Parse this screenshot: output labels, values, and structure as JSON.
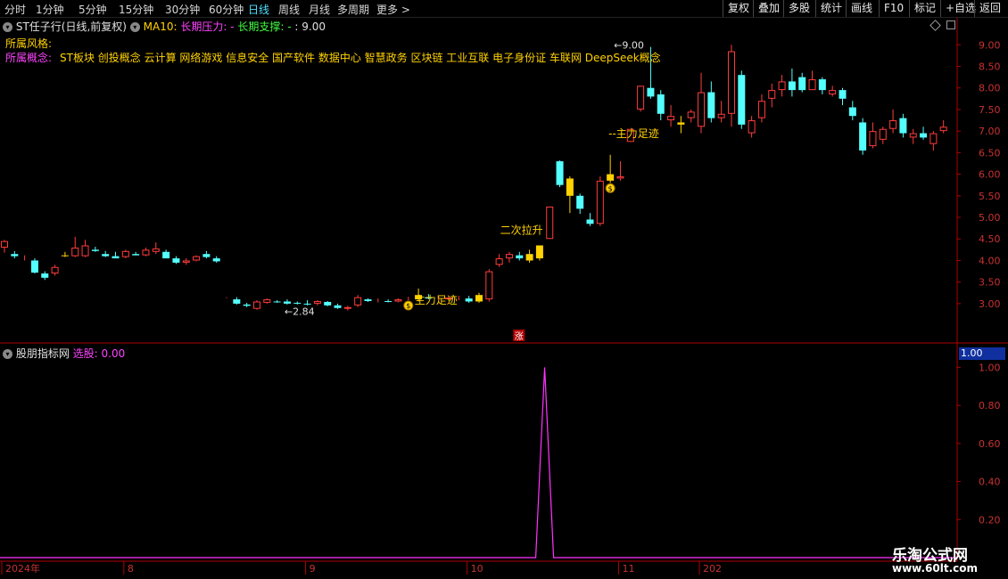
{
  "toolbar": {
    "left_items": [
      {
        "label": "分时",
        "active": false
      },
      {
        "label": "1分钟",
        "active": false
      },
      {
        "label": "5分钟",
        "active": false
      },
      {
        "label": "15分钟",
        "active": false
      },
      {
        "label": "30分钟",
        "active": false
      },
      {
        "label": "60分钟",
        "active": false
      },
      {
        "label": "日线",
        "active": true
      },
      {
        "label": "周线",
        "active": false
      },
      {
        "label": "月线",
        "active": false
      },
      {
        "label": "多周期",
        "active": false
      },
      {
        "label": "更多 >",
        "active": false
      }
    ],
    "right_items": [
      "复权",
      "叠加",
      "多股",
      "统计",
      "画线",
      "F10",
      "标记",
      "+自选",
      "返回"
    ]
  },
  "kline_info": {
    "title": "ST任子行(日线,前复权)",
    "ma": "MA10:",
    "pressure": "长期压力: -",
    "support": "长期支撑: -",
    "value": ": 9.00"
  },
  "concepts": {
    "style_label": "所属风格:",
    "concept_label": "所属概念:",
    "concept_value": "ST板块 创投概念 云计算 网络游戏 信息安全 国产软件 数据中心 智慧政务 区块链 工业互联 电子身份证 车联网 DeepSeek概念"
  },
  "indicator": {
    "name": "股朋指标网",
    "select_label": "选股: 0.00",
    "value_box": "1.00"
  },
  "watermark": {
    "title": "乐淘公式网",
    "url": "www.60lt.com"
  },
  "colors": {
    "up": "#ff3c3c",
    "down": "#54ffff",
    "highlight": "#ffd200",
    "indicator_line": "#ff33ff",
    "axis": "#b00000",
    "axis_text": "#c83232"
  },
  "chart_data": {
    "type": "candlestick",
    "price_axis": {
      "ticks": [
        "9.00",
        "8.50",
        "8.00",
        "7.50",
        "7.00",
        "6.50",
        "6.00",
        "5.50",
        "5.00",
        "4.50",
        "4.00",
        "3.50",
        "3.00"
      ],
      "range": [
        2.75,
        9.15
      ]
    },
    "indicator_axis": {
      "ticks": [
        "1.00",
        "0.80",
        "0.60",
        "0.40",
        "0.20"
      ],
      "range": [
        0,
        1.03
      ]
    },
    "x_labels": [
      {
        "label": "2024年",
        "index": 0
      },
      {
        "label": "8",
        "index": 12
      },
      {
        "label": "9",
        "index": 30
      },
      {
        "label": "10",
        "index": 46
      },
      {
        "label": "11",
        "index": 61
      },
      {
        "label": "202",
        "index": 69
      }
    ],
    "annotations": [
      {
        "text": "2.84",
        "index": 28,
        "price": 2.84
      },
      {
        "text": "主力足迹",
        "index": 40,
        "price": 3.0
      },
      {
        "text": "二次拉升",
        "index": 49,
        "price": 4.62
      },
      {
        "text": "9.00",
        "index": 60,
        "price": 9.0
      },
      {
        "text": "--主力足迹",
        "index": 60,
        "price": 6.86
      },
      {
        "text": "涨",
        "index": 51,
        "price": 2.77
      }
    ],
    "candles": [
      {
        "o": 4.3,
        "h": 4.48,
        "l": 4.18,
        "c": 4.45
      },
      {
        "o": 4.15,
        "h": 4.22,
        "l": 4.05,
        "c": 4.1
      },
      {
        "o": 4.05,
        "h": 4.12,
        "l": 4.0,
        "c": 4.05
      },
      {
        "o": 4.0,
        "h": 4.05,
        "l": 3.7,
        "c": 3.72
      },
      {
        "o": 3.7,
        "h": 3.75,
        "l": 3.55,
        "c": 3.6
      },
      {
        "o": 3.7,
        "h": 3.9,
        "l": 3.65,
        "c": 3.85
      },
      {
        "o": 4.1,
        "h": 4.2,
        "l": 4.08,
        "c": 4.12
      },
      {
        "o": 4.1,
        "h": 4.55,
        "l": 4.08,
        "c": 4.3
      },
      {
        "o": 4.1,
        "h": 4.48,
        "l": 4.08,
        "c": 4.35
      },
      {
        "o": 4.25,
        "h": 4.32,
        "l": 4.2,
        "c": 4.22
      },
      {
        "o": 4.15,
        "h": 4.22,
        "l": 4.08,
        "c": 4.1
      },
      {
        "o": 4.1,
        "h": 4.2,
        "l": 4.05,
        "c": 4.05
      },
      {
        "o": 4.08,
        "h": 4.25,
        "l": 4.05,
        "c": 4.22
      },
      {
        "o": 4.15,
        "h": 4.2,
        "l": 4.12,
        "c": 4.12
      },
      {
        "o": 4.12,
        "h": 4.3,
        "l": 4.1,
        "c": 4.25
      },
      {
        "o": 4.2,
        "h": 4.42,
        "l": 4.15,
        "c": 4.28
      },
      {
        "o": 4.2,
        "h": 4.25,
        "l": 4.05,
        "c": 4.05
      },
      {
        "o": 4.05,
        "h": 4.1,
        "l": 3.92,
        "c": 3.95
      },
      {
        "o": 3.95,
        "h": 4.05,
        "l": 3.9,
        "c": 4.0
      },
      {
        "o": 4.0,
        "h": 4.12,
        "l": 3.98,
        "c": 4.1
      },
      {
        "o": 4.15,
        "h": 4.22,
        "l": 4.05,
        "c": 4.08
      },
      {
        "o": 4.05,
        "h": 4.1,
        "l": 3.95,
        "c": 3.98
      },
      {
        "o": 3.14,
        "h": 3.15,
        "l": 3.13,
        "c": 3.14
      },
      {
        "o": 3.1,
        "h": 3.15,
        "l": 2.98,
        "c": 3.0
      },
      {
        "o": 2.98,
        "h": 3.02,
        "l": 2.92,
        "c": 2.95
      },
      {
        "o": 2.88,
        "h": 3.08,
        "l": 2.86,
        "c": 3.05
      },
      {
        "o": 3.02,
        "h": 3.12,
        "l": 3.0,
        "c": 3.1
      },
      {
        "o": 3.05,
        "h": 3.08,
        "l": 3.02,
        "c": 3.04
      },
      {
        "o": 3.05,
        "h": 3.1,
        "l": 2.98,
        "c": 3.0
      },
      {
        "o": 3.02,
        "h": 3.05,
        "l": 2.98,
        "c": 3.0
      },
      {
        "o": 3.0,
        "h": 3.08,
        "l": 2.96,
        "c": 2.98
      },
      {
        "o": 3.0,
        "h": 3.08,
        "l": 2.96,
        "c": 3.06
      },
      {
        "o": 3.04,
        "h": 3.06,
        "l": 2.94,
        "c": 2.96
      },
      {
        "o": 2.96,
        "h": 3.0,
        "l": 2.88,
        "c": 2.9
      },
      {
        "o": 2.88,
        "h": 2.95,
        "l": 2.84,
        "c": 2.92
      },
      {
        "o": 2.96,
        "h": 3.2,
        "l": 2.92,
        "c": 3.15
      },
      {
        "o": 3.1,
        "h": 3.12,
        "l": 3.04,
        "c": 3.06
      },
      {
        "o": 3.06,
        "h": 3.12,
        "l": 3.03,
        "c": 3.08
      },
      {
        "o": 3.06,
        "h": 3.1,
        "l": 3.03,
        "c": 3.04
      },
      {
        "o": 3.05,
        "h": 3.12,
        "l": 3.03,
        "c": 3.1
      },
      {
        "o": 3.12,
        "h": 3.16,
        "l": 3.08,
        "c": 3.14
      },
      {
        "o": 3.1,
        "h": 3.35,
        "l": 3.05,
        "c": 3.2
      },
      {
        "o": 3.15,
        "h": 3.22,
        "l": 3.1,
        "c": 3.12
      },
      {
        "o": 3.12,
        "h": 3.18,
        "l": 3.08,
        "c": 3.14
      },
      {
        "o": 3.1,
        "h": 3.16,
        "l": 3.06,
        "c": 3.14
      },
      {
        "o": 3.12,
        "h": 3.18,
        "l": 3.08,
        "c": 3.12
      },
      {
        "o": 3.12,
        "h": 3.18,
        "l": 3.02,
        "c": 3.05
      },
      {
        "o": 3.05,
        "h": 3.25,
        "l": 3.02,
        "c": 3.2
      },
      {
        "o": 3.1,
        "h": 3.8,
        "l": 3.05,
        "c": 3.75
      },
      {
        "o": 3.9,
        "h": 4.15,
        "l": 3.85,
        "c": 4.05
      },
      {
        "o": 4.05,
        "h": 4.2,
        "l": 3.95,
        "c": 4.15
      },
      {
        "o": 4.12,
        "h": 4.2,
        "l": 4.0,
        "c": 4.05
      },
      {
        "o": 4.0,
        "h": 4.25,
        "l": 3.95,
        "c": 4.15
      },
      {
        "o": 4.05,
        "h": 4.35,
        "l": 4.0,
        "c": 4.35
      },
      {
        "o": 4.5,
        "h": 5.25,
        "l": 4.5,
        "c": 5.25
      },
      {
        "o": 6.3,
        "h": 6.32,
        "l": 5.7,
        "c": 5.75
      },
      {
        "o": 5.9,
        "h": 5.95,
        "l": 5.1,
        "c": 5.5
      },
      {
        "o": 5.5,
        "h": 5.55,
        "l": 5.08,
        "c": 5.2
      },
      {
        "o": 4.95,
        "h": 5.1,
        "l": 4.8,
        "c": 4.85
      },
      {
        "o": 4.85,
        "h": 5.95,
        "l": 4.8,
        "c": 5.85
      },
      {
        "o": 5.85,
        "h": 6.45,
        "l": 5.8,
        "c": 6.0
      },
      {
        "o": 5.9,
        "h": 6.3,
        "l": 5.85,
        "c": 5.95
      },
      {
        "o": 6.75,
        "h": 7.05,
        "l": 6.75,
        "c": 7.05
      },
      {
        "o": 7.5,
        "h": 8.05,
        "l": 7.45,
        "c": 8.05
      },
      {
        "o": 8.0,
        "h": 8.95,
        "l": 7.75,
        "c": 7.8
      },
      {
        "o": 7.85,
        "h": 7.95,
        "l": 7.25,
        "c": 7.4
      },
      {
        "o": 7.25,
        "h": 7.6,
        "l": 7.1,
        "c": 7.35
      },
      {
        "o": 7.2,
        "h": 7.35,
        "l": 6.95,
        "c": 7.15
      },
      {
        "o": 7.3,
        "h": 7.5,
        "l": 7.2,
        "c": 7.45
      },
      {
        "o": 7.1,
        "h": 8.35,
        "l": 6.95,
        "c": 7.9
      },
      {
        "o": 7.9,
        "h": 8.15,
        "l": 7.2,
        "c": 7.3
      },
      {
        "o": 7.3,
        "h": 7.7,
        "l": 7.2,
        "c": 7.4
      },
      {
        "o": 7.4,
        "h": 9.0,
        "l": 7.1,
        "c": 8.85
      },
      {
        "o": 8.3,
        "h": 8.4,
        "l": 7.05,
        "c": 7.15
      },
      {
        "o": 6.95,
        "h": 7.35,
        "l": 6.85,
        "c": 7.25
      },
      {
        "o": 7.3,
        "h": 7.85,
        "l": 7.2,
        "c": 7.7
      },
      {
        "o": 7.75,
        "h": 8.1,
        "l": 7.55,
        "c": 7.95
      },
      {
        "o": 7.95,
        "h": 8.3,
        "l": 7.8,
        "c": 8.15
      },
      {
        "o": 8.15,
        "h": 8.45,
        "l": 7.8,
        "c": 7.95
      },
      {
        "o": 8.25,
        "h": 8.35,
        "l": 7.9,
        "c": 7.95
      },
      {
        "o": 7.95,
        "h": 8.4,
        "l": 7.95,
        "c": 8.2
      },
      {
        "o": 8.2,
        "h": 8.25,
        "l": 7.85,
        "c": 7.95
      },
      {
        "o": 7.85,
        "h": 8.05,
        "l": 7.8,
        "c": 7.95
      },
      {
        "o": 7.95,
        "h": 8.0,
        "l": 7.6,
        "c": 7.75
      },
      {
        "o": 7.55,
        "h": 7.7,
        "l": 7.25,
        "c": 7.35
      },
      {
        "o": 7.2,
        "h": 7.3,
        "l": 6.45,
        "c": 6.55
      },
      {
        "o": 6.65,
        "h": 7.2,
        "l": 6.6,
        "c": 7.0
      },
      {
        "o": 6.8,
        "h": 7.1,
        "l": 6.7,
        "c": 7.05
      },
      {
        "o": 7.05,
        "h": 7.5,
        "l": 6.95,
        "c": 7.25
      },
      {
        "o": 7.3,
        "h": 7.4,
        "l": 6.85,
        "c": 6.95
      },
      {
        "o": 6.85,
        "h": 7.05,
        "l": 6.7,
        "c": 6.95
      },
      {
        "o": 6.95,
        "h": 7.1,
        "l": 6.8,
        "c": 6.85
      },
      {
        "o": 6.7,
        "h": 7.0,
        "l": 6.55,
        "c": 6.95
      },
      {
        "o": 7.0,
        "h": 7.25,
        "l": 6.95,
        "c": 7.1
      }
    ],
    "highlight_indices": [
      6,
      41,
      47,
      52,
      53,
      56,
      60,
      67
    ],
    "indicator_signal_index": 53
  }
}
